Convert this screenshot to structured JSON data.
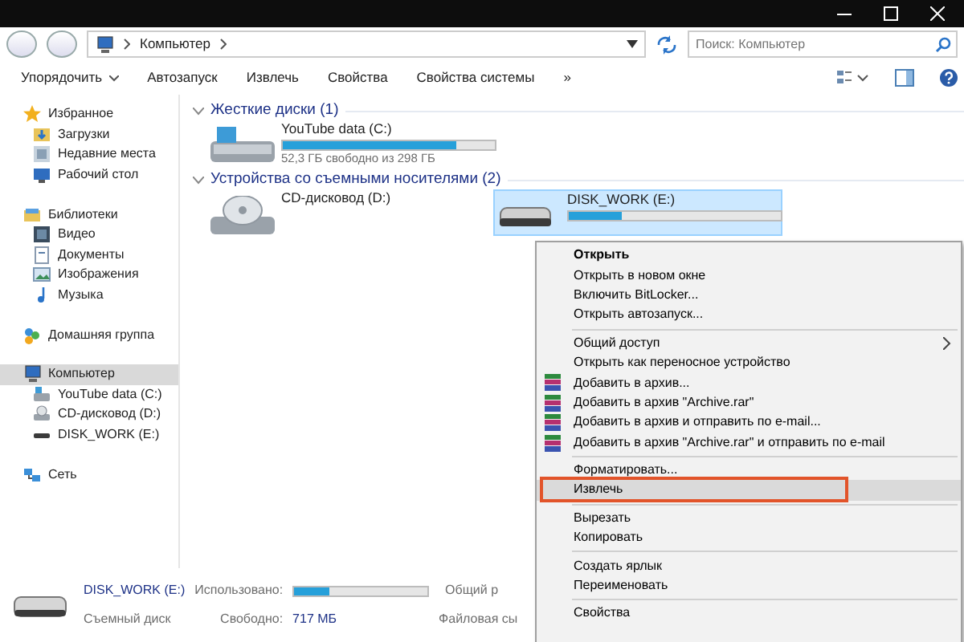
{
  "address_bar": {
    "path": [
      "Компьютер"
    ],
    "search": {
      "placeholder": "Поиск: Компьютер"
    }
  },
  "toolbar": [
    {
      "label": "Упорядочить",
      "kind": "dropdown"
    },
    {
      "label": "Автозапуск",
      "kind": "button"
    },
    {
      "label": "Извлечь",
      "kind": "button"
    },
    {
      "label": "Свойства",
      "kind": "button"
    },
    {
      "label": "Свойства системы",
      "kind": "button"
    },
    {
      "label": "»",
      "kind": "button"
    }
  ],
  "sidebar": [
    {
      "label": "Избранное",
      "kind": "star",
      "selected": false,
      "children": [
        {
          "label": "Загрузки",
          "kind": "download",
          "selected": false
        },
        {
          "label": "Недавние места",
          "kind": "recent",
          "selected": false
        },
        {
          "label": "Рабочий стол",
          "kind": "desktop",
          "selected": false
        }
      ]
    },
    {
      "label": "Библиотеки",
      "kind": "library",
      "selected": false,
      "children": [
        {
          "label": "Видео",
          "kind": "video",
          "selected": false
        },
        {
          "label": "Документы",
          "kind": "document",
          "selected": false
        },
        {
          "label": "Изображения",
          "kind": "image",
          "selected": false
        },
        {
          "label": "Музыка",
          "kind": "music",
          "selected": false
        }
      ]
    },
    {
      "label": "Домашняя группа",
      "kind": "homegroup",
      "selected": false
    },
    {
      "label": "Компьютер",
      "kind": "computer",
      "selected": true,
      "children": [
        {
          "label": "YouTube data (C:)",
          "kind": "hdd",
          "selected": false
        },
        {
          "label": "CD-дисковод (D:)",
          "kind": "cd",
          "selected": false
        },
        {
          "label": "DISK_WORK (E:)",
          "kind": "usb",
          "selected": false
        }
      ]
    },
    {
      "label": "Сеть",
      "kind": "network",
      "selected": false
    }
  ],
  "groups": [
    {
      "title": "Жесткие диски (1)",
      "drives": [
        {
          "name": "YouTube data (C:)",
          "kind": "hdd",
          "level": 0.82,
          "free": "52,3 ГБ свободно из 298 ГБ",
          "selected": false
        }
      ]
    },
    {
      "title": "Устройства со съемными носителями (2)",
      "drives": [
        {
          "name": "CD-дисковод (D:)",
          "kind": "cd",
          "selected": false
        },
        {
          "name": "DISK_WORK (E:)",
          "kind": "usb",
          "level": 0.25,
          "selected": true
        }
      ]
    }
  ],
  "context_menu": [
    {
      "label": "Открыть",
      "kind": "default",
      "highlighted": false
    },
    {
      "label": "Открыть в новом окне",
      "kind": "item",
      "highlighted": false
    },
    {
      "label": "Включить BitLocker...",
      "kind": "item",
      "highlighted": false
    },
    {
      "label": "Открыть автозапуск...",
      "kind": "item",
      "highlighted": false
    },
    {
      "kind": "separator"
    },
    {
      "label": "Общий доступ",
      "kind": "submenu",
      "highlighted": false
    },
    {
      "label": "Открыть как переносное устройство",
      "kind": "item",
      "highlighted": false
    },
    {
      "label": "Добавить в архив...",
      "kind": "archive",
      "highlighted": false
    },
    {
      "label": "Добавить в архив \"Archive.rar\"",
      "kind": "archive",
      "highlighted": false
    },
    {
      "label": "Добавить в архив и отправить по e-mail...",
      "kind": "archive",
      "highlighted": false
    },
    {
      "label": "Добавить в архив \"Archive.rar\" и отправить по e-mail",
      "kind": "archive",
      "highlighted": false
    },
    {
      "kind": "separator"
    },
    {
      "label": "Форматировать...",
      "kind": "item",
      "highlighted": false
    },
    {
      "label": "Извлечь",
      "kind": "item",
      "highlighted": true
    },
    {
      "kind": "separator"
    },
    {
      "label": "Вырезать",
      "kind": "item",
      "highlighted": false
    },
    {
      "label": "Копировать",
      "kind": "item",
      "highlighted": false
    },
    {
      "kind": "separator"
    },
    {
      "label": "Создать ярлык",
      "kind": "item",
      "highlighted": false
    },
    {
      "label": "Переименовать",
      "kind": "item",
      "highlighted": false
    },
    {
      "kind": "separator"
    },
    {
      "label": "Свойства",
      "kind": "item",
      "highlighted": false
    }
  ],
  "details": {
    "name": "DISK_WORK (E:)",
    "type": "Съемный диск",
    "used_label": "Использовано:",
    "level": 0.26,
    "free_label": "Свободно:",
    "free_value": "717 МБ",
    "shared_label": "Общий р",
    "fs_label": "Файловая сы"
  }
}
